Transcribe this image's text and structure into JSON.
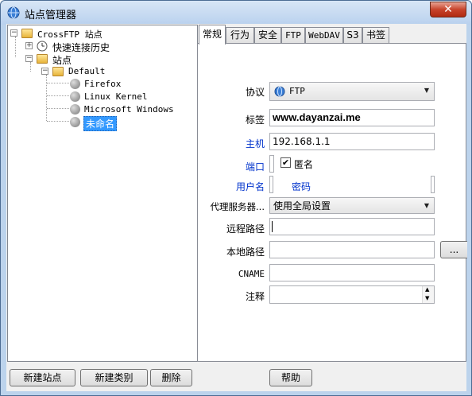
{
  "window": {
    "title": "站点管理器",
    "close_label": "✕"
  },
  "tree": {
    "root": "CrossFTP 站点",
    "history": "快速连接历史",
    "sites": "站点",
    "default": "Default",
    "items": [
      "Firefox",
      "Linux Kernel",
      "Microsoft Windows",
      "未命名"
    ],
    "expander_minus": "−",
    "expander_plus": "+"
  },
  "tabs": [
    "常规",
    "行为",
    "安全",
    "FTP",
    "WebDAV",
    "S3",
    "书签"
  ],
  "form": {
    "protocol_label": "协议",
    "protocol_value": "FTP",
    "tag_label": "标签",
    "tag_value": "www.dayanzai.me",
    "host_label": "主机",
    "host_value": "192.168.1.1",
    "port_label": "端口",
    "anonymous_label": "匿名",
    "anonymous_checked": true,
    "user_label": "用户名",
    "password_label": "密码",
    "proxy_label": "代理服务器...",
    "proxy_value": "使用全局设置",
    "remote_path_label": "远程路径",
    "remote_path_value": "",
    "local_path_label": "本地路径",
    "local_path_value": "",
    "browse_label": "...",
    "cname_label": "CNAME",
    "cname_value": "",
    "comment_label": "注释",
    "comment_value": ""
  },
  "buttons": {
    "new_site": "新建站点",
    "new_category": "新建类别",
    "delete": "删除",
    "help": "帮助"
  },
  "colors": {
    "selection": "#3399ff",
    "field_label_blue": "#0033cc",
    "titlebar": "#bcd3ec"
  }
}
